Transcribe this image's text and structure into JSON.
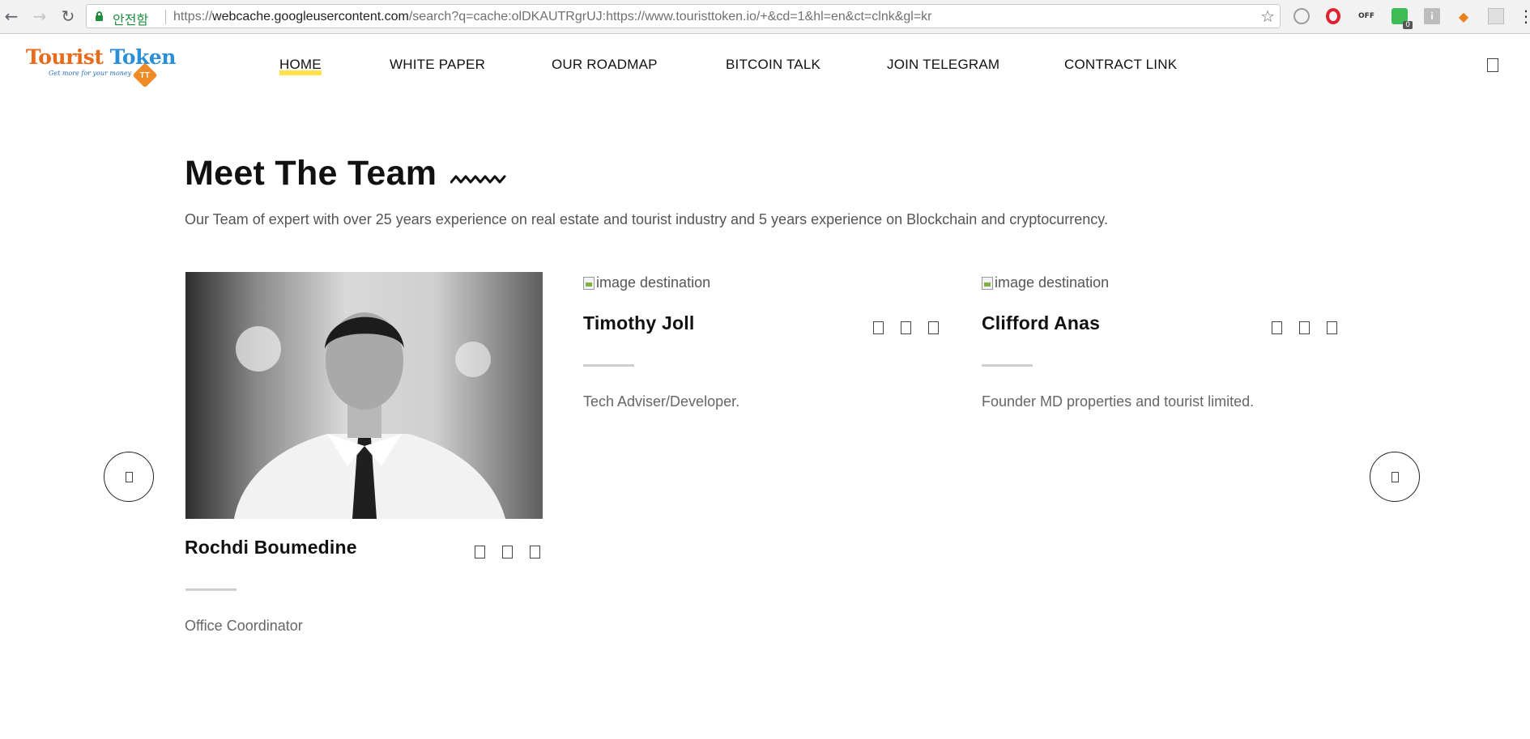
{
  "browser": {
    "secure_label": "안전함",
    "url_prefix": "https://",
    "url_host": "webcache.googleusercontent.com",
    "url_path": "/search?q=cache:olDKAUTRgrUJ:https://www.touristtoken.io/+&cd=1&hl=en&ct=clnk&gl=kr",
    "extension_off_label": "OFF",
    "extension_badge_count": "0",
    "extension_info_label": "i"
  },
  "logo": {
    "word1": "Tourist",
    "word2": "Token",
    "tagline": "Get more for your money",
    "badge": "TT"
  },
  "nav": {
    "items": [
      {
        "label": "HOME",
        "active": true
      },
      {
        "label": "WHITE PAPER"
      },
      {
        "label": "OUR ROADMAP"
      },
      {
        "label": "BITCOIN TALK"
      },
      {
        "label": "JOIN TELEGRAM"
      },
      {
        "label": "CONTRACT LINK"
      }
    ]
  },
  "section": {
    "title": "Meet The Team",
    "description": "Our Team of expert with over 25 years experience on real estate and tourist industry and 5 years experience on Blockchain and cryptocurrency."
  },
  "team": [
    {
      "name": "Rochdi Boumedine",
      "role": "Office Coordinator",
      "image_alt": ""
    },
    {
      "name": "Timothy Joll",
      "role": "Tech Adviser/Developer.",
      "image_alt": "image destination"
    },
    {
      "name": "Clifford Anas",
      "role": "Founder MD properties and tourist limited.",
      "image_alt": "image destination"
    }
  ],
  "colors": {
    "nav_active_highlight": "#ffe14a",
    "logo_orange": "#e86a1a",
    "logo_blue": "#2a8fd6",
    "secure_green": "#1e8e3e"
  },
  "icons": {
    "back": "arrow-left-icon",
    "forward": "arrow-right-icon",
    "reload": "reload-icon",
    "bookmark": "star-icon",
    "header": "search-icon",
    "carousel_prev": "chevron-left-icon",
    "carousel_next": "chevron-right-icon",
    "socials": [
      "facebook-icon",
      "twitter-icon",
      "linkedin-icon"
    ]
  }
}
